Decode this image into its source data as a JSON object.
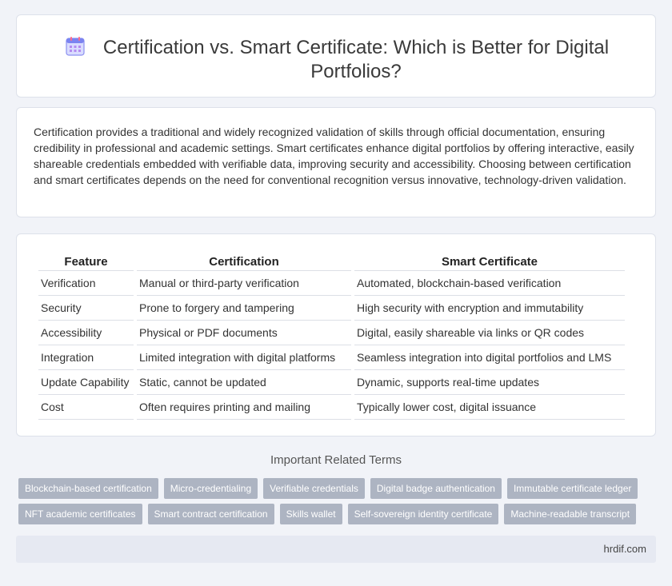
{
  "header": {
    "icon": "calendar-icon",
    "title": "Certification vs. Smart Certificate: Which is Better for Digital Portfolios?"
  },
  "intro": {
    "text": "Certification provides a traditional and widely recognized validation of skills through official documentation, ensuring credibility in professional and academic settings. Smart certificates enhance digital portfolios by offering interactive, easily shareable credentials embedded with verifiable data, improving security and accessibility. Choosing between certification and smart certificates depends on the need for conventional recognition versus innovative, technology-driven validation."
  },
  "table": {
    "headers": [
      "Feature",
      "Certification",
      "Smart Certificate"
    ],
    "rows": [
      [
        "Verification",
        "Manual or third-party verification",
        "Automated, blockchain-based verification"
      ],
      [
        "Security",
        "Prone to forgery and tampering",
        "High security with encryption and immutability"
      ],
      [
        "Accessibility",
        "Physical or PDF documents",
        "Digital, easily shareable via links or QR codes"
      ],
      [
        "Integration",
        "Limited integration with digital platforms",
        "Seamless integration into digital portfolios and LMS"
      ],
      [
        "Update Capability",
        "Static, cannot be updated",
        "Dynamic, supports real-time updates"
      ],
      [
        "Cost",
        "Often requires printing and mailing",
        "Typically lower cost, digital issuance"
      ]
    ]
  },
  "related": {
    "title": "Important Related Terms",
    "tags": [
      "Blockchain-based certification",
      "Micro-credentialing",
      "Verifiable credentials",
      "Digital badge authentication",
      "Immutable certificate ledger",
      "NFT academic certificates",
      "Smart contract certification",
      "Skills wallet",
      "Self-sovereign identity certificate",
      "Machine-readable transcript"
    ]
  },
  "footer": {
    "site": "hrdif.com"
  },
  "colors": {
    "tag_bg": "#adb4c2",
    "page_bg": "#f1f3f8",
    "footer_bg": "#e6e9f2"
  }
}
